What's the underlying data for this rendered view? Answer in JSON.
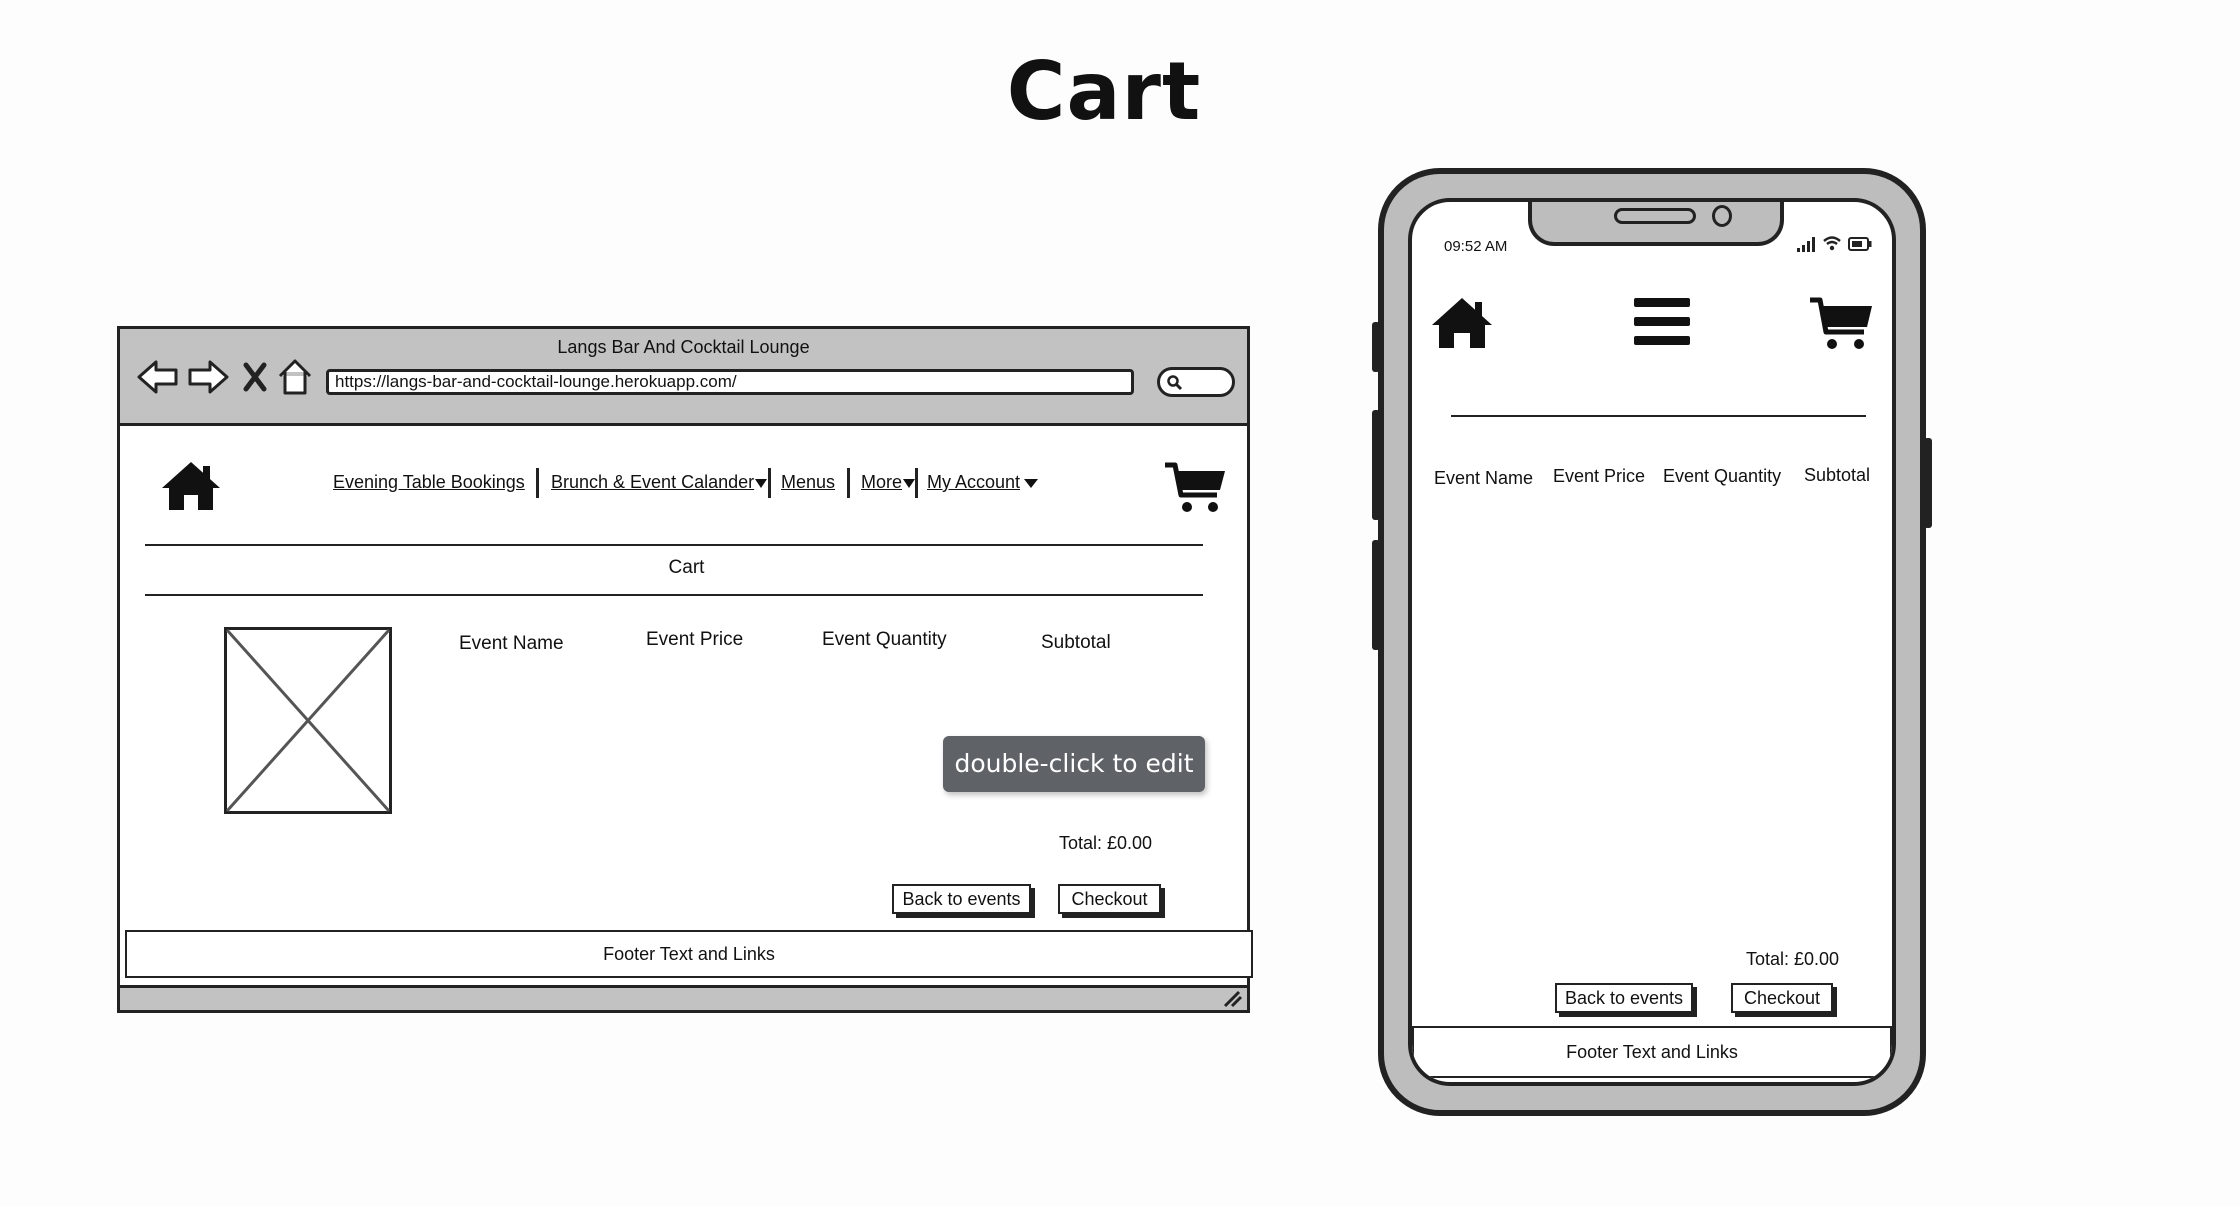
{
  "page": {
    "title": "Cart"
  },
  "browser": {
    "window_title": "Langs Bar And Cocktail Lounge",
    "url": "https://langs-bar-and-cocktail-lounge.herokuapp.com/",
    "nav": {
      "evening": "Evening Table Bookings",
      "brunch": "Brunch & Event Calander",
      "menus": "Menus",
      "more": "More",
      "account": "My Account"
    },
    "section_title": "Cart",
    "columns": {
      "name": "Event Name",
      "price": "Event Price",
      "quantity": "Event Quantity",
      "subtotal": "Subtotal"
    },
    "tooltip": "double-click to edit",
    "total": "Total: £0.00",
    "back_button": "Back to events",
    "checkout_button": "Checkout",
    "footer": "Footer Text and Links"
  },
  "phone": {
    "time": "09:52 AM",
    "columns": {
      "name": "Event Name",
      "price": "Event Price",
      "quantity": "Event Quantity",
      "subtotal": "Subtotal"
    },
    "total": "Total: £0.00",
    "back_button": "Back to events",
    "checkout_button": "Checkout",
    "footer": "Footer Text and Links"
  },
  "icons": [
    "back-arrow-icon",
    "forward-arrow-icon",
    "close-icon",
    "home-icon",
    "search-icon",
    "cart-icon",
    "hamburger-menu-icon",
    "signal-icon",
    "wifi-icon",
    "battery-icon",
    "image-placeholder-icon",
    "resize-grip-icon",
    "dropdown-caret-icon"
  ]
}
